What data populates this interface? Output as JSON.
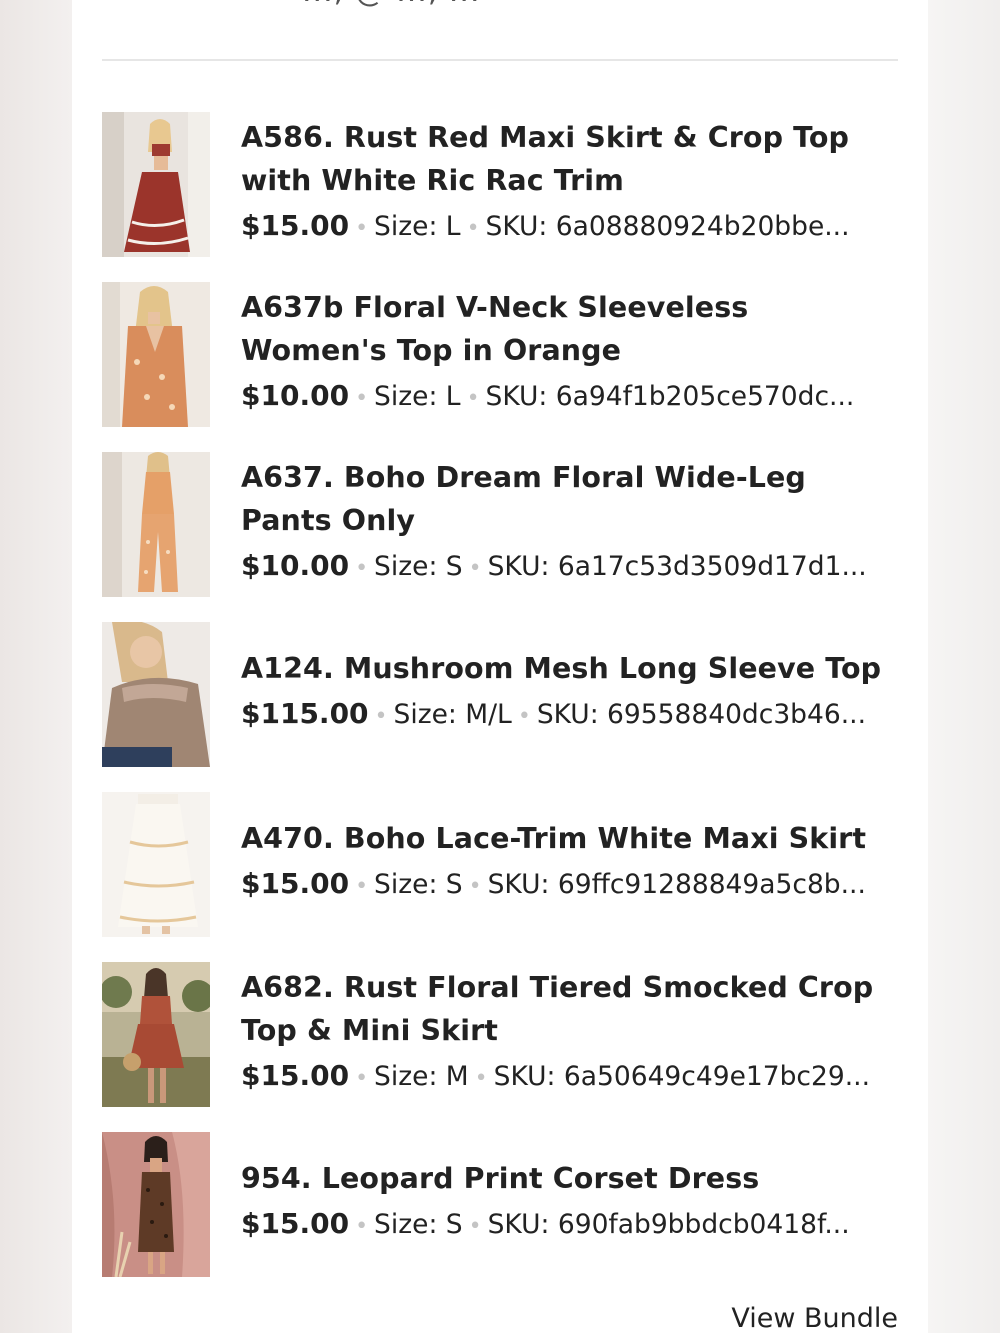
{
  "header": {
    "cut_text": "..., @ ..., ..."
  },
  "items": [
    {
      "title": "A586. Rust Red Maxi Skirt & Crop Top with White Ric Rac Trim",
      "price": "$15.00",
      "size": "Size: L",
      "sku": "SKU: 6a08880924b20bbe..."
    },
    {
      "title": "A637b Floral V-Neck Sleeveless Women's Top in Orange",
      "price": "$10.00",
      "size": "Size: L",
      "sku": "SKU: 6a94f1b205ce570dc..."
    },
    {
      "title": "A637. Boho Dream Floral Wide-Leg Pants Only",
      "price": "$10.00",
      "size": "Size: S",
      "sku": "SKU: 6a17c53d3509d17d1..."
    },
    {
      "title": "A124. Mushroom Mesh Long Sleeve Top",
      "price": "$115.00",
      "size": "Size: M/L",
      "sku": "SKU: 69558840dc3b46..."
    },
    {
      "title": "A470. Boho Lace-Trim White Maxi Skirt",
      "price": "$15.00",
      "size": "Size: S",
      "sku": "SKU: 69ffc91288849a5c8b..."
    },
    {
      "title": "A682. Rust Floral Tiered Smocked Crop Top & Mini Skirt",
      "price": "$15.00",
      "size": "Size: M",
      "sku": "SKU: 6a50649c49e17bc29..."
    },
    {
      "title": "954. Leopard Print Corset Dress",
      "price": "$15.00",
      "size": "Size: S",
      "sku": "SKU: 690fab9bbdcb0418f..."
    }
  ],
  "footer": {
    "view_bundle_label": "View Bundle"
  },
  "colors": {
    "text": "#222222",
    "separator_dot": "#c4c4c4",
    "divider": "#e6e6e6"
  }
}
